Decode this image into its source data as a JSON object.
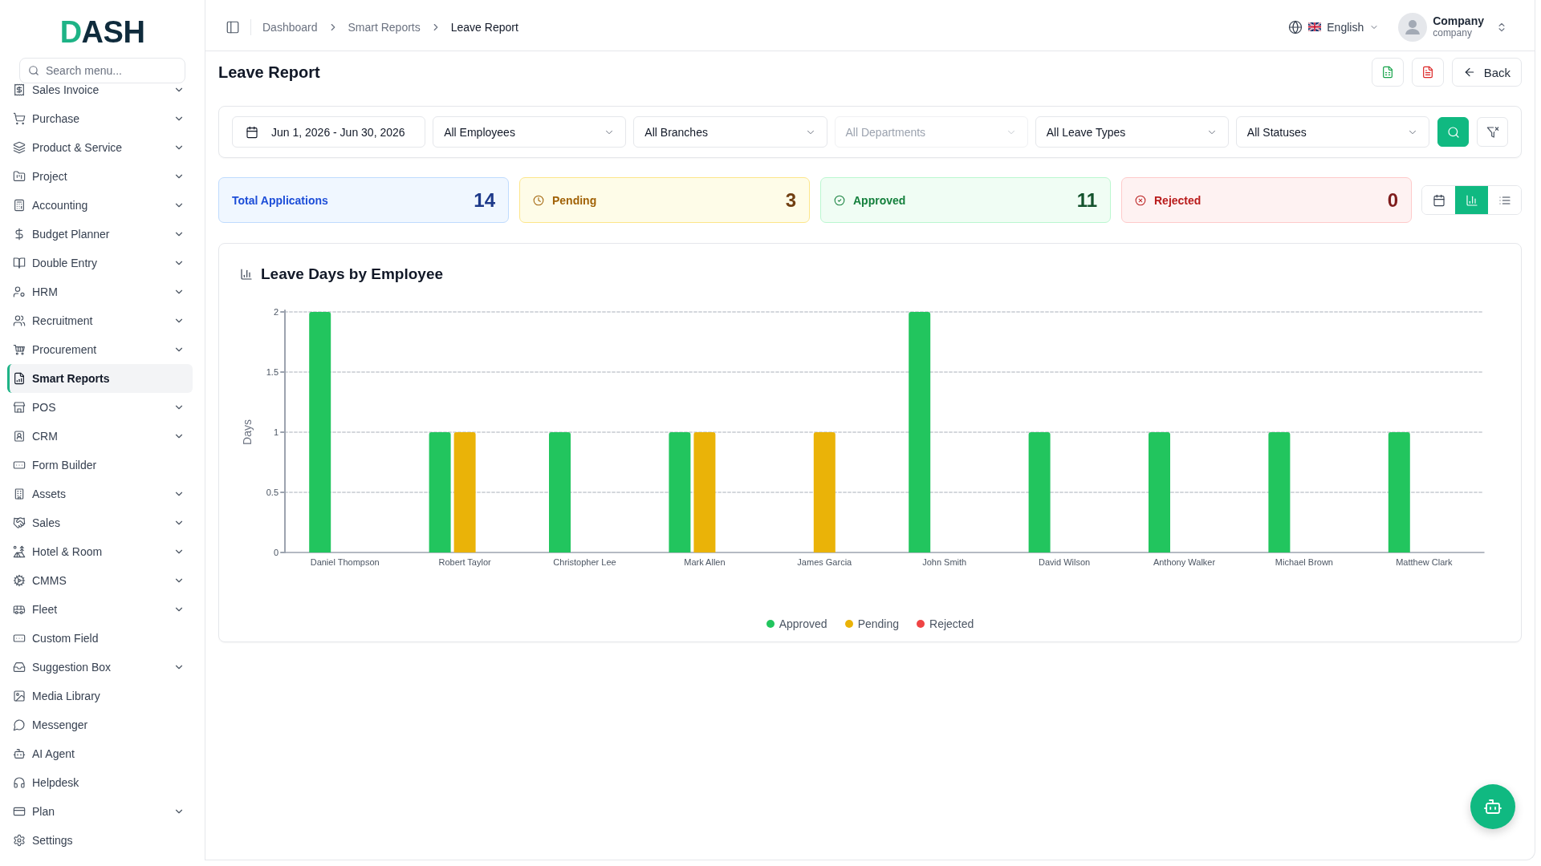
{
  "logo": {
    "text": "DASH"
  },
  "sidebar": {
    "search": {
      "placeholder": "Search menu..."
    },
    "items": [
      {
        "label": "Sales Invoice",
        "expandable": true,
        "selected": false
      },
      {
        "label": "Purchase",
        "expandable": true,
        "selected": false
      },
      {
        "label": "Product & Service",
        "expandable": true,
        "selected": false
      },
      {
        "label": "Project",
        "expandable": true,
        "selected": false
      },
      {
        "label": "Accounting",
        "expandable": true,
        "selected": false
      },
      {
        "label": "Budget Planner",
        "expandable": true,
        "selected": false
      },
      {
        "label": "Double Entry",
        "expandable": true,
        "selected": false
      },
      {
        "label": "HRM",
        "expandable": true,
        "selected": false
      },
      {
        "label": "Recruitment",
        "expandable": true,
        "selected": false
      },
      {
        "label": "Procurement",
        "expandable": true,
        "selected": false
      },
      {
        "label": "Smart Reports",
        "expandable": false,
        "selected": true
      },
      {
        "label": "POS",
        "expandable": true,
        "selected": false
      },
      {
        "label": "CRM",
        "expandable": true,
        "selected": false
      },
      {
        "label": "Form Builder",
        "expandable": false,
        "selected": false
      },
      {
        "label": "Assets",
        "expandable": true,
        "selected": false
      },
      {
        "label": "Sales",
        "expandable": true,
        "selected": false
      },
      {
        "label": "Hotel & Room",
        "expandable": true,
        "selected": false
      },
      {
        "label": "CMMS",
        "expandable": true,
        "selected": false
      },
      {
        "label": "Fleet",
        "expandable": true,
        "selected": false
      },
      {
        "label": "Custom Field",
        "expandable": false,
        "selected": false
      },
      {
        "label": "Suggestion Box",
        "expandable": true,
        "selected": false
      },
      {
        "label": "Media Library",
        "expandable": false,
        "selected": false
      },
      {
        "label": "Messenger",
        "expandable": false,
        "selected": false
      },
      {
        "label": "AI Agent",
        "expandable": false,
        "selected": false
      },
      {
        "label": "Helpdesk",
        "expandable": false,
        "selected": false
      },
      {
        "label": "Plan",
        "expandable": true,
        "selected": false
      },
      {
        "label": "Settings",
        "expandable": false,
        "selected": false
      }
    ]
  },
  "topbar": {
    "breadcrumbs": [
      {
        "label": "Dashboard",
        "current": false
      },
      {
        "label": "Smart Reports",
        "current": false
      },
      {
        "label": "Leave Report",
        "current": true
      }
    ],
    "language": {
      "label": "English"
    },
    "user": {
      "name": "Company",
      "role": "company"
    }
  },
  "page": {
    "title": "Leave Report",
    "back_button": {
      "label": "Back"
    }
  },
  "filters": [
    {
      "kind": "date",
      "value": "Jun 1, 2026 - Jun 30, 2026",
      "disabled": false
    },
    {
      "kind": "select",
      "value": "All Employees",
      "disabled": false
    },
    {
      "kind": "select",
      "value": "All Branches",
      "disabled": false
    },
    {
      "kind": "select",
      "value": "All Departments",
      "disabled": true
    },
    {
      "kind": "select",
      "value": "All Leave Types",
      "disabled": false
    },
    {
      "kind": "select",
      "value": "All Statuses",
      "disabled": false
    }
  ],
  "stats": [
    {
      "kind": "total",
      "label": "Total Applications",
      "value": "14"
    },
    {
      "kind": "pending",
      "label": "Pending",
      "value": "3"
    },
    {
      "kind": "approved",
      "label": "Approved",
      "value": "11"
    },
    {
      "kind": "rejected",
      "label": "Rejected",
      "value": "0"
    }
  ],
  "view_toggle": [
    {
      "selected": false
    },
    {
      "selected": true
    },
    {
      "selected": false
    }
  ],
  "chart": {
    "chart_data": {
      "type": "bar",
      "title": "Leave Days by Employee",
      "ylabel": "Days",
      "categories": [
        "Daniel Thompson",
        "Robert Taylor",
        "Christopher Lee",
        "Mark Allen",
        "James Garcia",
        "John Smith",
        "David Wilson",
        "Anthony Walker",
        "Michael Brown",
        "Matthew Clark"
      ],
      "series": [
        {
          "name": "Approved",
          "color": "#22c55e",
          "values": [
            2,
            1,
            1,
            1,
            0,
            2,
            1,
            1,
            1,
            1
          ]
        },
        {
          "name": "Pending",
          "color": "#eab308",
          "values": [
            0,
            1,
            0,
            1,
            1,
            0,
            0,
            0,
            0,
            0
          ]
        },
        {
          "name": "Rejected",
          "color": "#ef4444",
          "values": [
            0,
            0,
            0,
            0,
            0,
            0,
            0,
            0,
            0,
            0
          ]
        }
      ],
      "ylim": [
        0,
        2
      ],
      "yticks": [
        0,
        0.5,
        1,
        1.5,
        2
      ],
      "grid": true,
      "legend": "bottom"
    }
  }
}
